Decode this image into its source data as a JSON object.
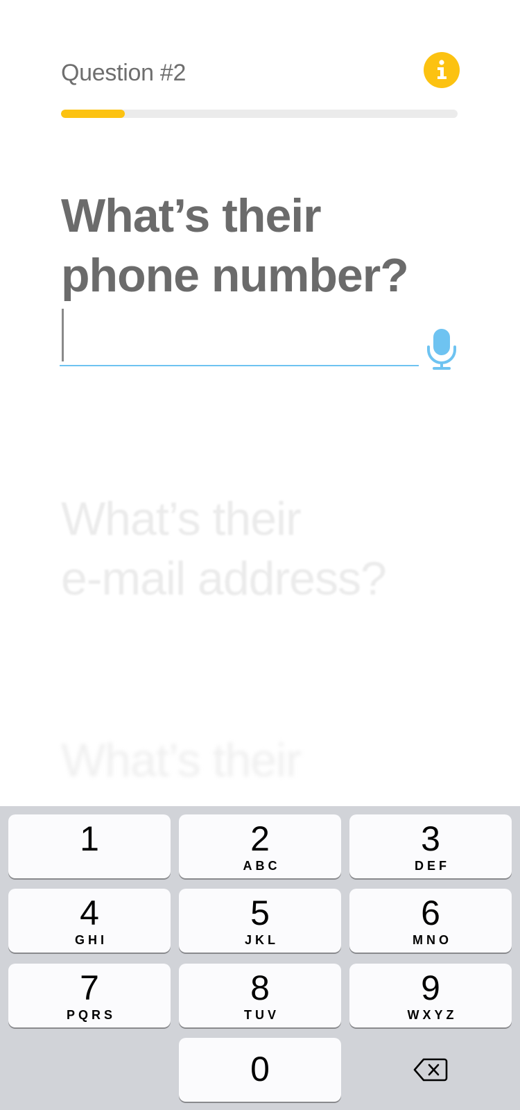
{
  "header": {
    "question_label": "Question #2",
    "info_icon": "info-icon",
    "progress": 0.16,
    "accent_color": "#fcc211"
  },
  "questions": {
    "current": {
      "line1": "What’s their",
      "line2": "phone number?"
    },
    "next": {
      "line1": "What’s their",
      "line2": "e-mail address?"
    },
    "later": {
      "line1": "What’s their"
    }
  },
  "answer": {
    "value": "",
    "mic_icon": "microphone-icon",
    "underline_color": "#6ec3f1"
  },
  "keypad": {
    "keys": [
      {
        "digit": "1",
        "letters": ""
      },
      {
        "digit": "2",
        "letters": "ABC"
      },
      {
        "digit": "3",
        "letters": "DEF"
      },
      {
        "digit": "4",
        "letters": "GHI"
      },
      {
        "digit": "5",
        "letters": "JKL"
      },
      {
        "digit": "6",
        "letters": "MNO"
      },
      {
        "digit": "7",
        "letters": "PQRS"
      },
      {
        "digit": "8",
        "letters": "TUV"
      },
      {
        "digit": "9",
        "letters": "WXYZ"
      },
      {
        "digit": "0",
        "letters": ""
      }
    ],
    "delete_icon": "backspace-icon"
  }
}
